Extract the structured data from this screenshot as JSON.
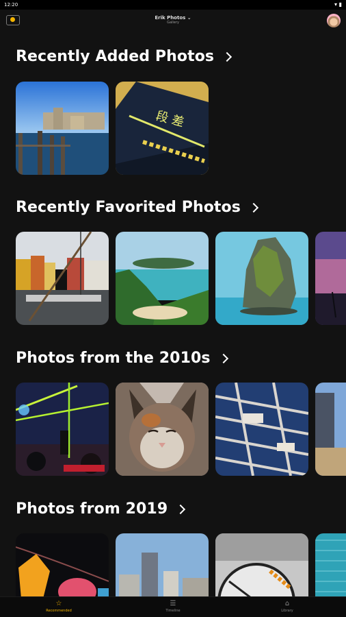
{
  "status": {
    "time": "12:20"
  },
  "appbar": {
    "title": "Erik Photos",
    "subtitle": "Gallery"
  },
  "sections": [
    {
      "title": "Recently Added Photos"
    },
    {
      "title": "Recently Favorited Photos"
    },
    {
      "title": "Photos from the 2010s"
    },
    {
      "title": "Photos from 2019"
    }
  ],
  "nav": [
    {
      "label": "Recommended",
      "icon": "star-icon"
    },
    {
      "label": "Timeline",
      "icon": "timeline-icon"
    },
    {
      "label": "Library",
      "icon": "library-icon"
    }
  ],
  "colors": {
    "accent": "#f4b400",
    "background": "#121212"
  }
}
